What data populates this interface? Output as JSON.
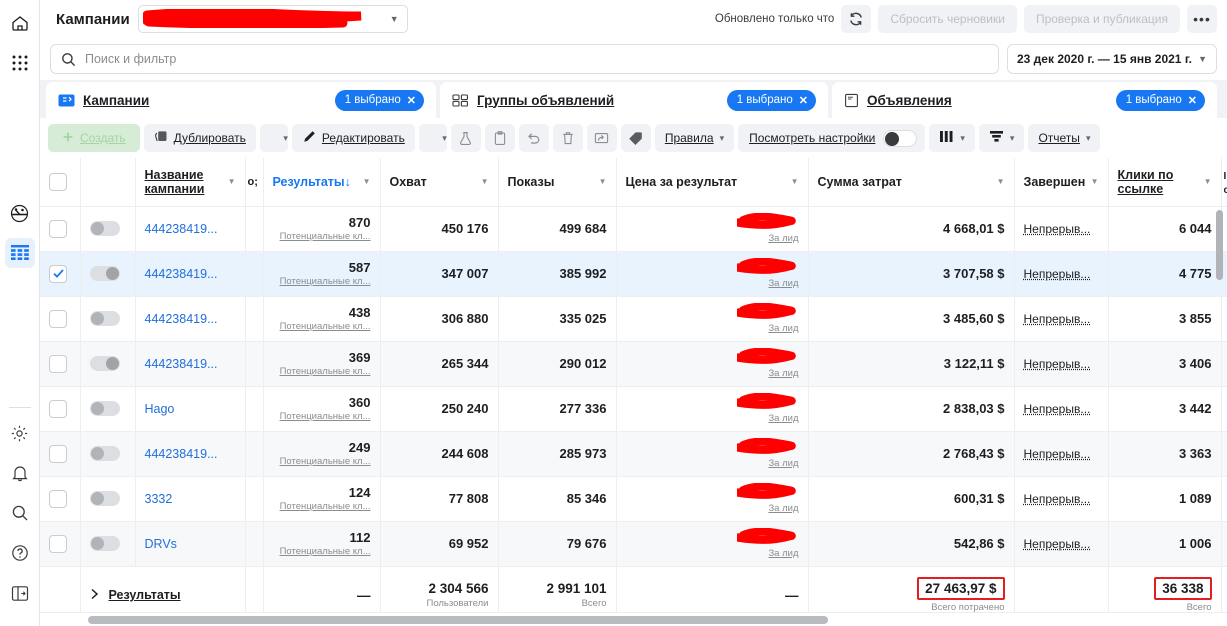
{
  "rail": {
    "items": [
      {
        "name": "home-icon",
        "label": "Главная"
      },
      {
        "name": "apps-grid-icon",
        "label": "Все инструменты"
      },
      {
        "name": "dashboard-icon",
        "label": "Обзор"
      },
      {
        "name": "table-icon",
        "label": "Менеджер рекламы"
      }
    ],
    "bottom": [
      {
        "name": "gear-icon",
        "label": "Настройки"
      },
      {
        "name": "bell-icon",
        "label": "Уведомления"
      },
      {
        "name": "search-icon",
        "label": "Поиск"
      },
      {
        "name": "help-icon",
        "label": "Справка"
      },
      {
        "name": "panel-icon",
        "label": "Свернуть панель"
      }
    ]
  },
  "topbar": {
    "account_label": "Кампании",
    "account_value": "",
    "updated_text": "Обновлено только что",
    "refresh_icon": "refresh-icon",
    "discard_label": "Сбросить черновики",
    "review_label": "Проверка и публикация",
    "more_label": "•••"
  },
  "search": {
    "placeholder": "Поиск и фильтр",
    "icon": "search-icon",
    "date_range": "23 дек 2020 г. — 15 янв 2021 г."
  },
  "tabs": [
    {
      "label": "Кампании",
      "icon": "campaign-icon",
      "badge": "1 выбрано",
      "close": "✕",
      "active": true
    },
    {
      "label": "Группы объявлений",
      "icon": "adset-icon",
      "badge": "1 выбрано",
      "close": "✕",
      "active": false
    },
    {
      "label": "Объявления",
      "icon": "ad-icon",
      "badge": "1 выбрано",
      "close": "✕",
      "active": false
    }
  ],
  "toolbar": {
    "create_label": "Создать",
    "create_icon": "plus-icon",
    "duplicate_label": "Дублировать",
    "duplicate_icon": "copy-icon",
    "duplicate_caret": "▾",
    "edit_label": "Редактировать",
    "edit_icon": "pencil-icon",
    "edit_caret": "▾",
    "ab_test_icon": "flask-icon",
    "clipboard_icon": "clipboard-icon",
    "undo_icon": "undo-icon",
    "delete_icon": "trash-icon",
    "export_icon": "export-icon",
    "tag_icon": "tag-icon",
    "rules_label": "Правила",
    "rules_caret": "▾",
    "view_setup_label": "Посмотреть настройки",
    "columns_icon": "columns-icon",
    "columns_caret": "▾",
    "breakdown_icon": "breakdown-icon",
    "breakdown_caret": "▾",
    "reports_label": "Отчеты",
    "reports_caret": "▾"
  },
  "table": {
    "columns": [
      {
        "key": "check",
        "label": ""
      },
      {
        "key": "toggle",
        "label": ""
      },
      {
        "key": "name",
        "label": "Название кампании",
        "underline": true
      },
      {
        "key": "partial",
        "label": "о;"
      },
      {
        "key": "results",
        "label": "Результаты↓",
        "sorted": true
      },
      {
        "key": "reach",
        "label": "Охват"
      },
      {
        "key": "impressions",
        "label": "Показы"
      },
      {
        "key": "cost_per_result",
        "label": "Цена за результат"
      },
      {
        "key": "spend",
        "label": "Сумма затрат"
      },
      {
        "key": "ends",
        "label": "Завершен"
      },
      {
        "key": "link_clicks",
        "label": "Клики по ссылке",
        "underline": true
      },
      {
        "key": "edge",
        "label": ""
      }
    ],
    "rows": [
      {
        "name": "444238419...",
        "selected": false,
        "toggle": "off",
        "results": "870",
        "results_sub": "Потенциальные кл...",
        "reach": "450 176",
        "impressions": "499 684",
        "cpr_redacted": true,
        "cpr_sub": "За лид",
        "spend": "4 668,01 $",
        "ends": "Непрерыв...",
        "link_clicks": "6 044"
      },
      {
        "name": "444238419...",
        "selected": true,
        "toggle": "on",
        "results": "587",
        "results_sub": "Потенциальные кл...",
        "reach": "347 007",
        "impressions": "385 992",
        "cpr_redacted": true,
        "cpr_sub": "За лид",
        "spend": "3 707,58 $",
        "ends": "Непрерыв...",
        "link_clicks": "4 775"
      },
      {
        "name": "444238419...",
        "selected": false,
        "toggle": "off",
        "results": "438",
        "results_sub": "Потенциальные кл...",
        "reach": "306 880",
        "impressions": "335 025",
        "cpr_redacted": true,
        "cpr_sub": "За лид",
        "spend": "3 485,60 $",
        "ends": "Непрерыв...",
        "link_clicks": "3 855"
      },
      {
        "name": "444238419...",
        "selected": false,
        "toggle": "on",
        "results": "369",
        "results_sub": "Потенциальные кл...",
        "reach": "265 344",
        "impressions": "290 012",
        "cpr_redacted": true,
        "cpr_sub": "За лид",
        "spend": "3 122,11 $",
        "ends": "Непрерыв...",
        "link_clicks": "3 406"
      },
      {
        "name": "Hago",
        "selected": false,
        "toggle": "off",
        "results": "360",
        "results_sub": "Потенциальные кл...",
        "reach": "250 240",
        "impressions": "277 336",
        "cpr_redacted": true,
        "cpr_sub": "За лид",
        "spend": "2 838,03 $",
        "ends": "Непрерыв...",
        "link_clicks": "3 442"
      },
      {
        "name": "444238419...",
        "selected": false,
        "toggle": "off",
        "results": "249",
        "results_sub": "Потенциальные кл...",
        "reach": "244 608",
        "impressions": "285 973",
        "cpr_redacted": true,
        "cpr_sub": "За лид",
        "spend": "2 768,43 $",
        "ends": "Непрерыв...",
        "link_clicks": "3 363"
      },
      {
        "name": "3332",
        "selected": false,
        "toggle": "off",
        "results": "124",
        "results_sub": "Потенциальные кл...",
        "reach": "77 808",
        "impressions": "85 346",
        "cpr_redacted": true,
        "cpr_sub": "За лид",
        "spend": "600,31 $",
        "ends": "Непрерыв...",
        "link_clicks": "1 089"
      },
      {
        "name": "DRVs",
        "selected": false,
        "toggle": "off",
        "results": "112",
        "results_sub": "Потенциальные кл...",
        "reach": "69 952",
        "impressions": "79 676",
        "cpr_redacted": true,
        "cpr_sub": "За лид",
        "spend": "542,86 $",
        "ends": "Непрерыв...",
        "link_clicks": "1 006"
      }
    ],
    "totals": {
      "expand_icon": "chevron-right-icon",
      "label": "Результаты",
      "results": "—",
      "reach": "2 304 566",
      "reach_sub": "Пользователи",
      "impressions": "2 991 101",
      "impressions_sub": "Всего",
      "cost_per_result": "—",
      "spend": "27 463,97 $",
      "spend_sub": "Всего потрачено",
      "spend_highlight": "#e02020",
      "ends": "",
      "link_clicks": "36 338",
      "link_clicks_sub": "Всего",
      "link_clicks_highlight": "#e02020"
    }
  },
  "colors": {
    "accent": "#1877f2",
    "link": "#216fdb",
    "redaction": "#fe0000",
    "highlight_box": "#e02020",
    "panel_bg": "#f0f2f5"
  }
}
